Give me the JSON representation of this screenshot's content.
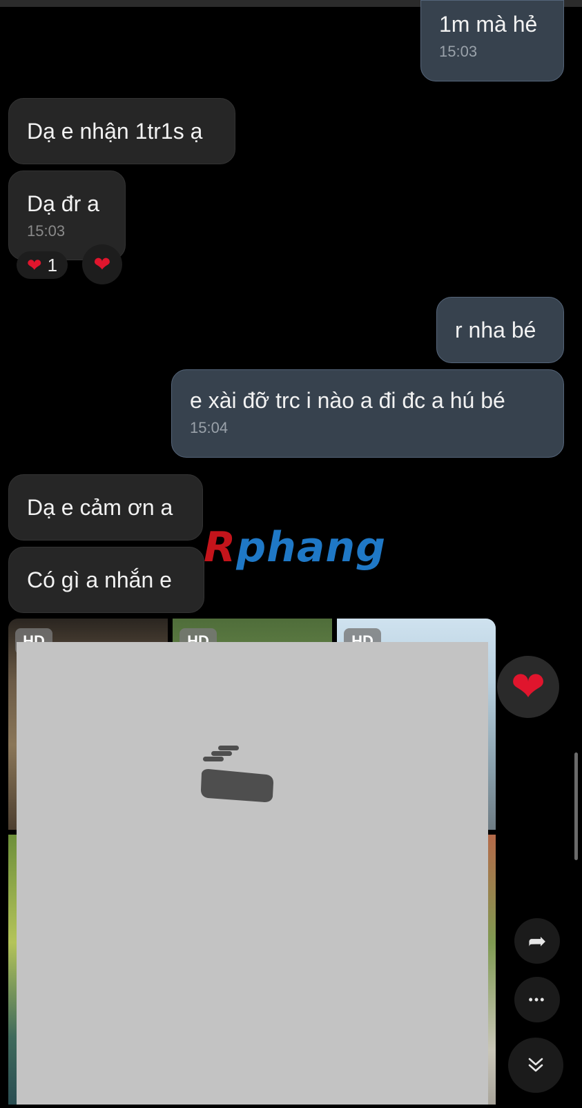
{
  "messages": {
    "m1": {
      "text": "1m mà hẻ",
      "time": "15:03"
    },
    "m2": {
      "text": "Dạ e nhận 1tr1s ạ"
    },
    "m3": {
      "text": "Dạ đr a",
      "time": "15:03",
      "reaction_count": "1"
    },
    "m4": {
      "text": "r nha bé"
    },
    "m5": {
      "text": "e xài đỡ trc i nào a đi đc a hú bé",
      "time": "15:04"
    },
    "m6": {
      "text": "Dạ e cảm ơn a"
    },
    "m7": {
      "text": "Có gì a nhắn e"
    }
  },
  "reactions": {
    "heart_glyph": "❤",
    "add_heart_glyph": "❤"
  },
  "watermark": {
    "first": "R",
    "rest": "phang"
  },
  "photos": {
    "badges": [
      "HD",
      "HD",
      "HD"
    ]
  },
  "side": {
    "heart_glyph": "❤",
    "forward_glyph": "➦",
    "more_glyph": "•••",
    "down_glyph": "⌄"
  },
  "colors": {
    "sent_bubble": "#37424e",
    "received_bubble": "#262626",
    "heart": "#e0152d",
    "background": "#000000"
  }
}
